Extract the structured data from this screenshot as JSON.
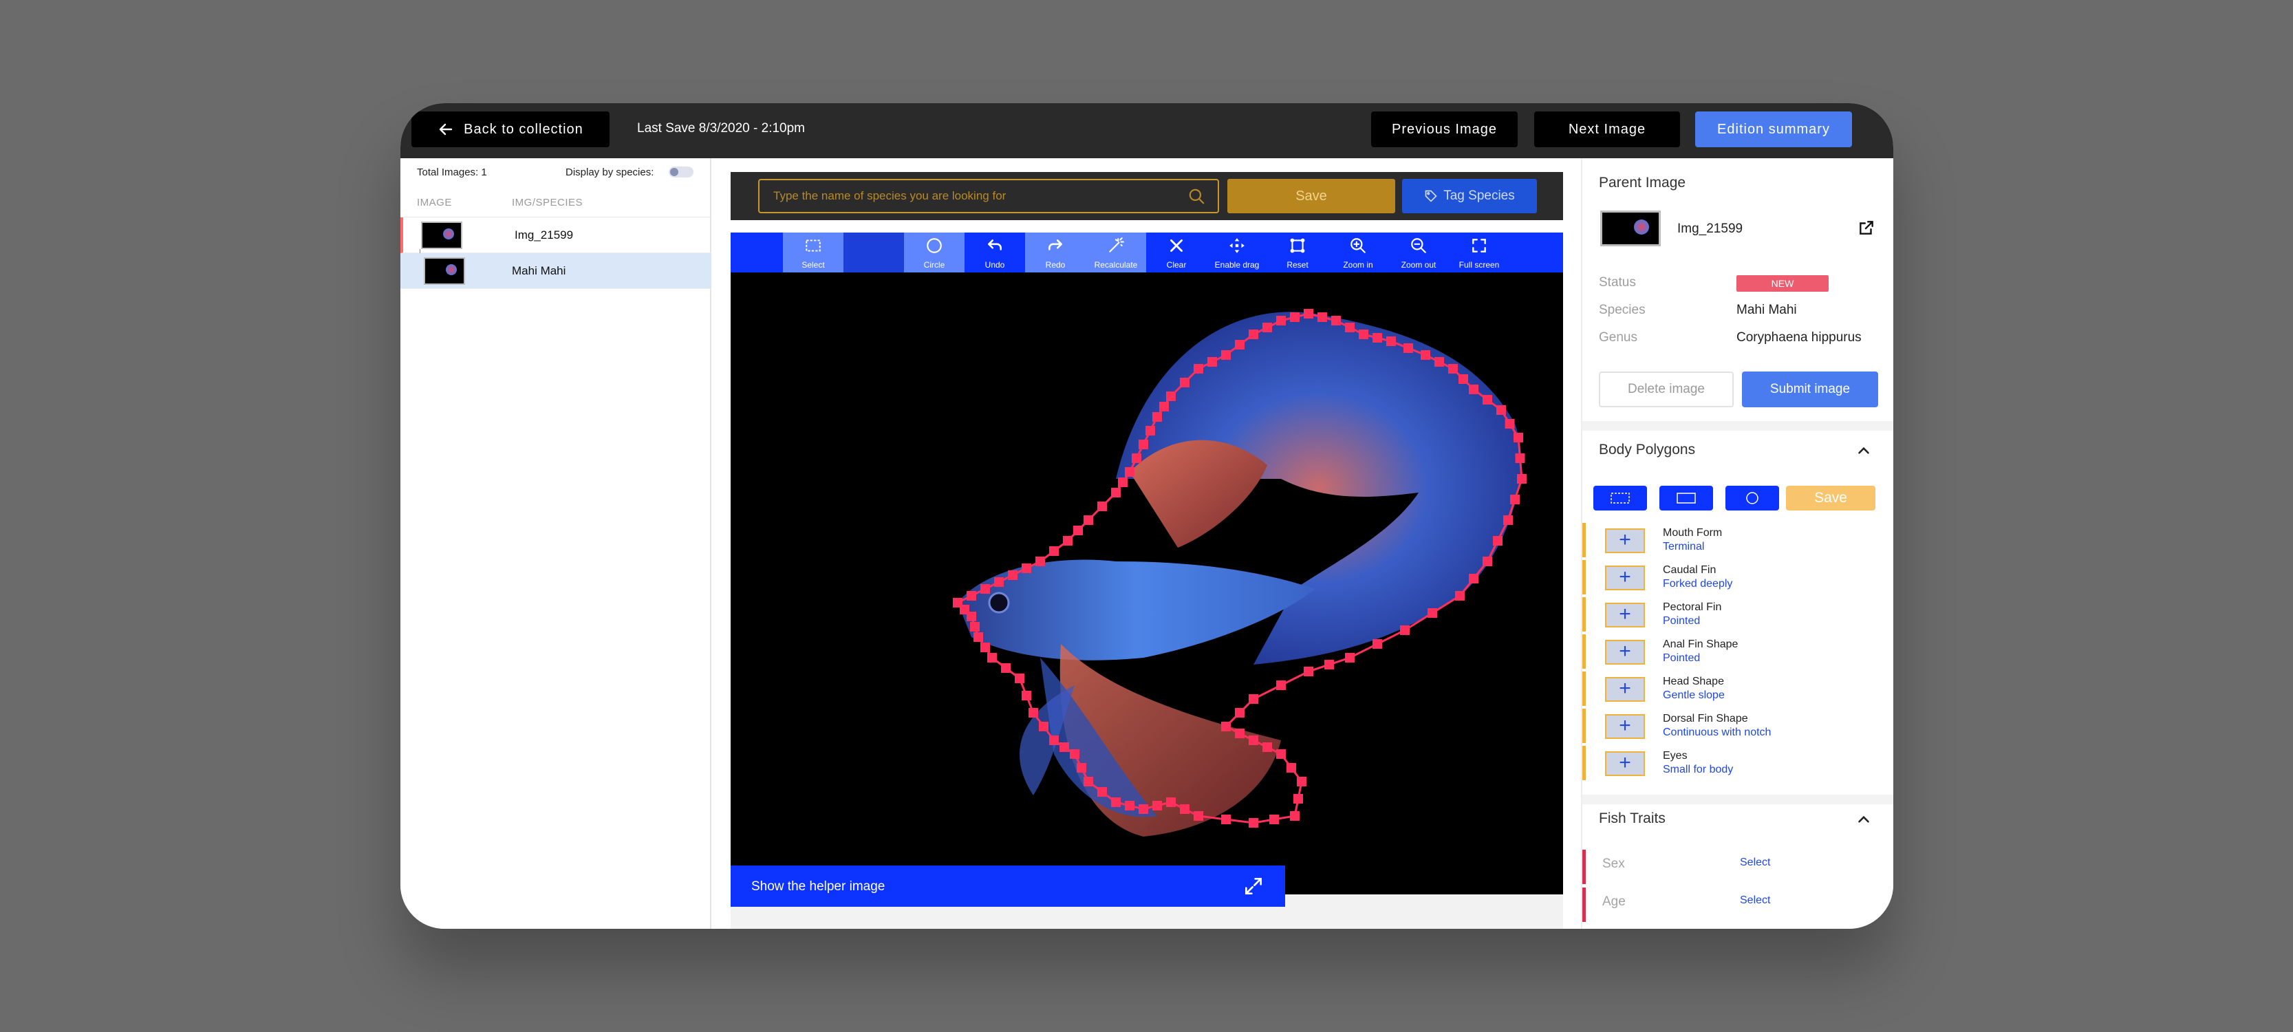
{
  "topbar": {
    "back_label": "Back to collection",
    "last_save": "Last Save 8/3/2020 - 2:10pm",
    "prev_label": "Previous Image",
    "next_label": "Next Image",
    "edition_label": "Edition summary"
  },
  "left_panel": {
    "total_images": "Total Images: 1",
    "display_by_species": "Display by species:",
    "col_image": "IMAGE",
    "col_species": "IMG/SPECIES",
    "rows": [
      {
        "label": "Img_21599"
      },
      {
        "label": "Mahi Mahi"
      }
    ]
  },
  "search": {
    "placeholder": "Type the name of species you are looking for",
    "save_label": "Save",
    "tag_label": "Tag Species"
  },
  "toolbar": {
    "tools": [
      {
        "label": "Select",
        "icon": "select-icon"
      },
      {
        "label": "",
        "icon": "blank"
      },
      {
        "label": "Circle",
        "icon": "circle-icon"
      },
      {
        "label": "Undo",
        "icon": "undo-icon"
      },
      {
        "label": "Redo",
        "icon": "redo-icon"
      },
      {
        "label": "Recalculate",
        "icon": "wand-icon"
      },
      {
        "label": "Clear",
        "icon": "close-icon"
      },
      {
        "label": "Enable drag",
        "icon": "move-icon"
      },
      {
        "label": "Reset",
        "icon": "reset-icon"
      },
      {
        "label": "Zoom in",
        "icon": "zoom-in-icon"
      },
      {
        "label": "Zoom out",
        "icon": "zoom-out-icon"
      },
      {
        "label": "Full screen",
        "icon": "fullscreen-icon"
      }
    ]
  },
  "helper": {
    "label": "Show the helper image"
  },
  "right_panel": {
    "parent_title": "Parent Image",
    "parent_name": "Img_21599",
    "status_key": "Status",
    "status_value": "NEW",
    "species_key": "Species",
    "species_value": "Mahi Mahi",
    "genus_key": "Genus",
    "genus_value": "Coryphaena hippurus",
    "delete_label": "Delete image",
    "submit_label": "Submit image",
    "body_polygons_title": "Body Polygons",
    "shape_save_label": "Save",
    "traits": [
      {
        "name": "Mouth Form",
        "value": "Terminal"
      },
      {
        "name": "Caudal Fin",
        "value": "Forked deeply"
      },
      {
        "name": "Pectoral Fin",
        "value": "Pointed"
      },
      {
        "name": "Anal Fin Shape",
        "value": "Pointed"
      },
      {
        "name": "Head Shape",
        "value": "Gentle slope"
      },
      {
        "name": "Dorsal Fin Shape",
        "value": "Continuous with notch"
      },
      {
        "name": "Eyes",
        "value": "Small for body"
      }
    ],
    "fish_traits_title": "Fish Traits",
    "fish_traits": [
      {
        "name": "Sex",
        "value": "Select"
      },
      {
        "name": "Age",
        "value": "Select"
      }
    ]
  },
  "colors": {
    "accent_blue": "#0c33ff",
    "submit_blue": "#4a7cf0",
    "polygon_pink": "#ff2f5b",
    "gold": "#b8861f",
    "badge_red": "#ee5b6e"
  }
}
